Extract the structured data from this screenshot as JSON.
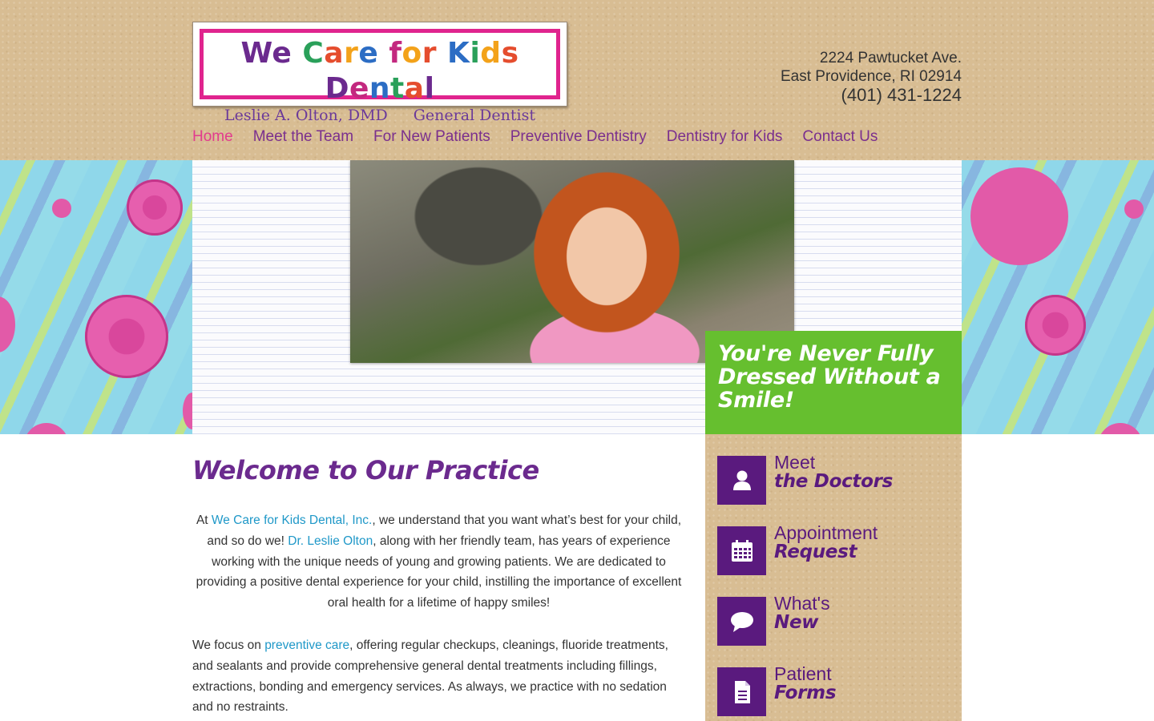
{
  "logo": {
    "title": "We Care for Kids Dental",
    "doctor": "Leslie A. Olton, DMD",
    "specialty": "General Dentist"
  },
  "address": {
    "street": "2224 Pawtucket Ave.",
    "city": "East Providence, RI 02914",
    "phone": "(401) 431-1224"
  },
  "nav": [
    {
      "label": "Home"
    },
    {
      "label": "Meet the Team"
    },
    {
      "label": "For New Patients"
    },
    {
      "label": "Preventive Dentistry"
    },
    {
      "label": "Dentistry for Kids"
    },
    {
      "label": "Contact Us"
    }
  ],
  "hero": {
    "tagline": "You're Never Fully Dressed Without a Smile!"
  },
  "main": {
    "heading": "Welcome to Our Practice",
    "p1_pre": "At ",
    "p1_link1": "We Care for Kids Dental, Inc.",
    "p1_mid": ", we understand that you want what’s best for your child, and so do we! ",
    "p1_link2": "Dr. Leslie Olton",
    "p1_post": ", along with her friendly team, has years of experience working with the unique needs of young and growing patients. We are dedicated to providing a positive dental experience for your child, instilling the importance of excellent oral health for a lifetime of happy smiles!",
    "p2_pre": "We focus on ",
    "p2_link": "preventive care",
    "p2_post": ", offering regular checkups, cleanings, fluoride treatments, and sealants and provide comprehensive general dental treatments including fillings, extractions, bonding and emergency services. As always, we practice with no sedation and no restraints."
  },
  "sidebar": [
    {
      "line1": "Meet",
      "line2": "the Doctors",
      "icon": "user-icon"
    },
    {
      "line1": "Appointment",
      "line2": "Request",
      "icon": "calendar-icon"
    },
    {
      "line1": "What's",
      "line2": "New",
      "icon": "speech-bubble-icon"
    },
    {
      "line1": "Patient",
      "line2": "Forms",
      "icon": "document-icon"
    }
  ],
  "colors": {
    "brand_purple": "#6b2a8e",
    "nav_active": "#e23b8e",
    "link": "#1f98c8",
    "tagline_green": "#66bf2f",
    "icon_bg": "#5a1a7e"
  }
}
